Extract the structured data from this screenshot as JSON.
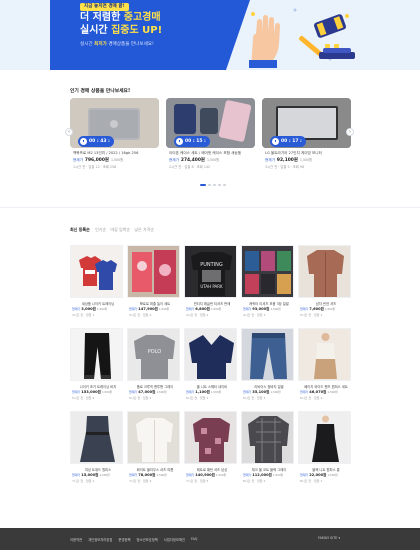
{
  "hero": {
    "badge": "지금 놓치면 경매 끝!",
    "line1_a": "더 저렴한",
    "line1_b": "중고경매",
    "line2_a": "실시간",
    "line2_b": "집중도 UP!",
    "sub_a": "실시간",
    "sub_b": "최저가",
    "sub_c": "경매상품을 만나보세요!"
  },
  "popular": {
    "title": "인기 경매 상품을 만나보세요!",
    "price_label": "현재가",
    "unit": "1,500원",
    "cards": [
      {
        "timer": "00 : 43 :",
        "name": "맥북프로 M2 13인치 / 2022 / 16gb 256",
        "price": "796,000원",
        "meta": "1시간 전 · 입찰 12 · 조회 256"
      },
      {
        "timer": "00 : 15 :",
        "name": "아이폰 케이스 세트 / 에어팟 케이스 포함 새상품",
        "price": "274,400원",
        "meta": "2시간 전 · 입찰 8 · 조회 142"
      },
      {
        "timer": "00 : 17 :",
        "name": "LG 울트라기어 27인치 게이밍 모니터",
        "price": "92,100원",
        "meta": "3시간 전 · 입찰 5 · 조회 98"
      }
    ]
  },
  "list": {
    "title": "최신 등록순",
    "options": [
      "인기순",
      "마감 임박순",
      "낮은 가격순"
    ],
    "price_label": "현재가",
    "unit": "1,500원",
    "items": [
      {
        "name": "새상품 나이키 트레이닝",
        "price": "3,000원",
        "meta": "3시간 전 · 입찰 1"
      },
      {
        "name": "뽀로로 퍼즐 놀이 세트",
        "price": "147,900원",
        "meta": "3시간 전 · 입찰 4"
      },
      {
        "name": "빈티지 래글런 티셔츠 판매",
        "price": "6,800원",
        "meta": "4시간 전 · 입찰 2"
      },
      {
        "name": "캐릭터 티셔츠 모음 3장 일괄",
        "price": "93,000원",
        "meta": "4시간 전 · 입찰 3"
      },
      {
        "name": "남자 린넨 셔츠",
        "price": "7,600원",
        "meta": "5시간 전 · 입찰 1"
      },
      {
        "name": "나이키 조거 트레이닝 바지",
        "price": "153,000원",
        "meta": "5시간 전 · 입찰 6"
      },
      {
        "name": "폴로 크루넥 맨투맨 그레이",
        "price": "47,000원",
        "meta": "5시간 전 · 입찰 2"
      },
      {
        "name": "울 니트 스웨터 네이비",
        "price": "1,100원",
        "meta": "6시간 전 · 입찰 1"
      },
      {
        "name": "리바이스 청바지 일괄",
        "price": "35,100원",
        "meta": "6시간 전 · 입찰 3"
      },
      {
        "name": "베이지 와이드 팬츠 원피스 세트",
        "price": "46,070원",
        "meta": "6시간 전 · 입찰 2"
      },
      {
        "name": "여성 트위드 원피스",
        "price": "15,000원",
        "meta": "7시간 전 · 입찰 1"
      },
      {
        "name": "화이트 블라우스 셔츠 여름",
        "price": "78,000원",
        "meta": "7시간 전 · 입찰 4"
      },
      {
        "name": "레트로 패턴 셔츠 남성",
        "price": "140,900원",
        "meta": "7시간 전 · 입찰 5"
      },
      {
        "name": "체크 울 코트 블랙 그레이",
        "price": "112,000원",
        "meta": "8시간 전 · 입찰 2"
      },
      {
        "name": "블랙 니트 원피스 롱",
        "price": "22,000원",
        "meta": "8시간 전 · 입찰 1"
      }
    ]
  },
  "footer": {
    "links": [
      "이용약관",
      "개인정보처리방침",
      "운영정책",
      "청소년보호정책",
      "사업자정보확인",
      "FAQ"
    ],
    "family": "FAMILY SITE ▾"
  },
  "colors": {
    "accent": "#2a5bd7",
    "highlight": "#ffe14a",
    "footer": "#3a3a3a"
  }
}
